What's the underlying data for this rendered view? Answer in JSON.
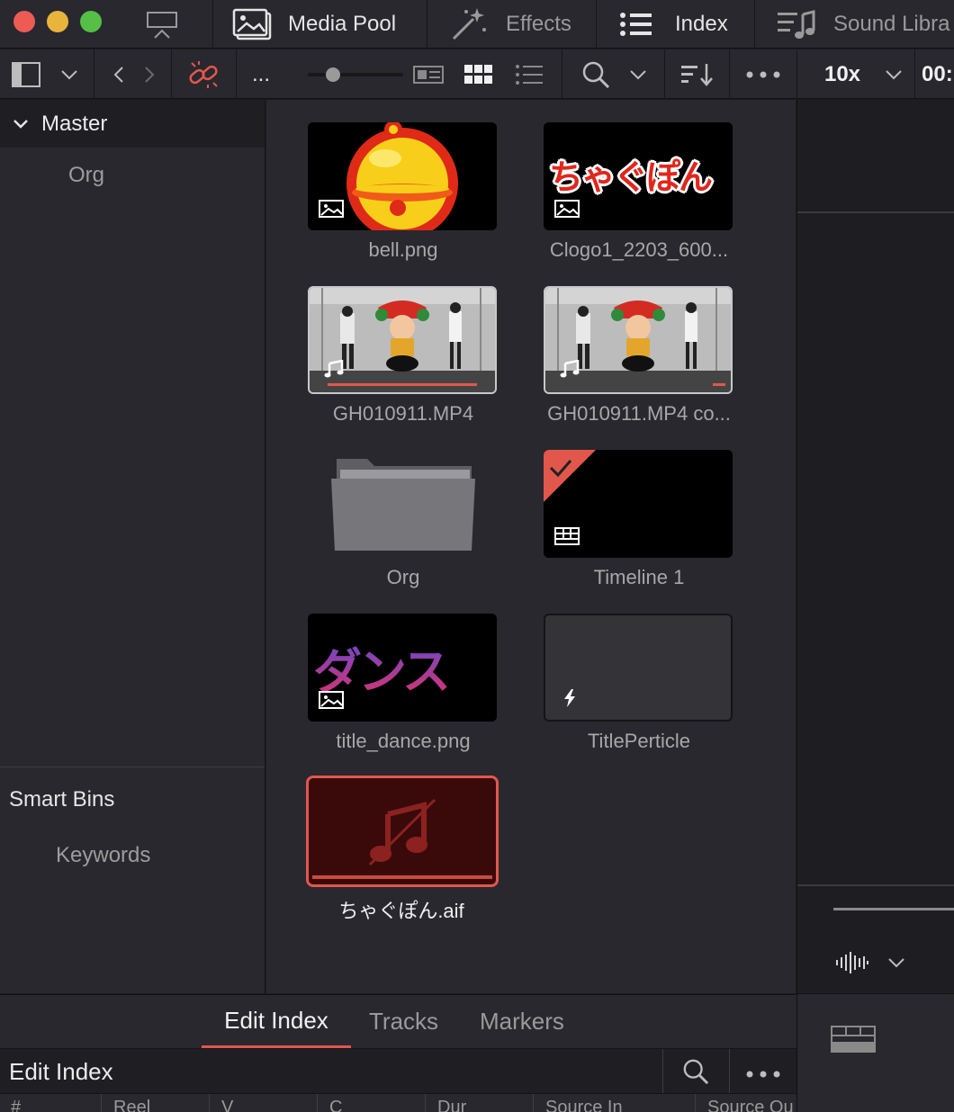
{
  "topbar": {
    "media_pool": "Media Pool",
    "effects": "Effects",
    "index": "Index",
    "sound_library": "Sound Libra"
  },
  "toolbar": {
    "more_label": "...",
    "zoom": "10x",
    "timecode": "00:"
  },
  "bins": {
    "master": "Master",
    "org": "Org",
    "smart_bins_title": "Smart Bins",
    "keywords": "Keywords"
  },
  "clips": [
    {
      "name": "bell.png",
      "kind": "image"
    },
    {
      "name": "Clogo1_2203_600...",
      "kind": "image"
    },
    {
      "name": "GH010911.MP4",
      "kind": "video-audio"
    },
    {
      "name": "GH010911.MP4 co...",
      "kind": "video-audio"
    },
    {
      "name": "Org",
      "kind": "folder"
    },
    {
      "name": "Timeline 1",
      "kind": "timeline"
    },
    {
      "name": "title_dance.png",
      "kind": "image"
    },
    {
      "name": "TitlePerticle",
      "kind": "title-effect"
    },
    {
      "name": "ちゃぐぽん.aif",
      "kind": "audio-offline"
    }
  ],
  "thumb_text": {
    "logo": "ちゃぐぽん",
    "dance": "ダンス"
  },
  "index_panel": {
    "tabs": [
      "Edit Index",
      "Tracks",
      "Markers"
    ],
    "active_tab": "Edit Index",
    "title": "Edit Index",
    "columns": [
      "#",
      "Reel",
      "V",
      "C",
      "Dur",
      "Source In",
      "Source Ou"
    ]
  },
  "colors": {
    "accent_red": "#e2574c",
    "panel": "#28282e",
    "selected_clip_bg": "#3a0a0b"
  }
}
